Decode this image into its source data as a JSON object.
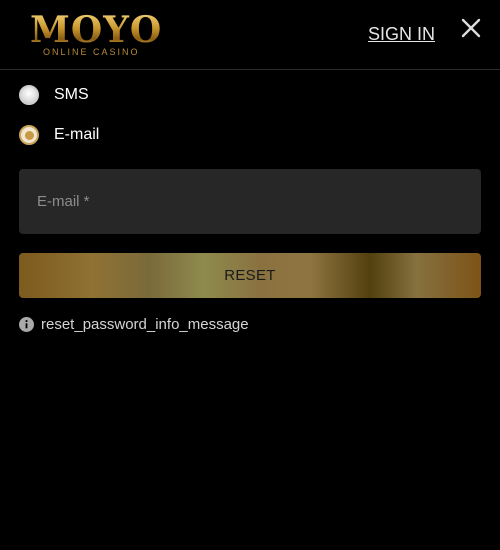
{
  "header": {
    "logo_main": "MOYO",
    "logo_sub": "ONLINE CASINO",
    "sign_in_label": "SIGN IN",
    "close_icon": "close-icon"
  },
  "method": {
    "options": [
      {
        "label": "SMS",
        "selected": false
      },
      {
        "label": "E-mail",
        "selected": true
      }
    ]
  },
  "form": {
    "email_placeholder": "E-mail *",
    "email_value": "",
    "reset_label": "RESET"
  },
  "info": {
    "icon": "info-icon",
    "message": "reset_password_info_message"
  },
  "colors": {
    "background": "#000000",
    "input_background": "#272727",
    "accent_gold": "#c99a45",
    "text": "#ffffff"
  }
}
